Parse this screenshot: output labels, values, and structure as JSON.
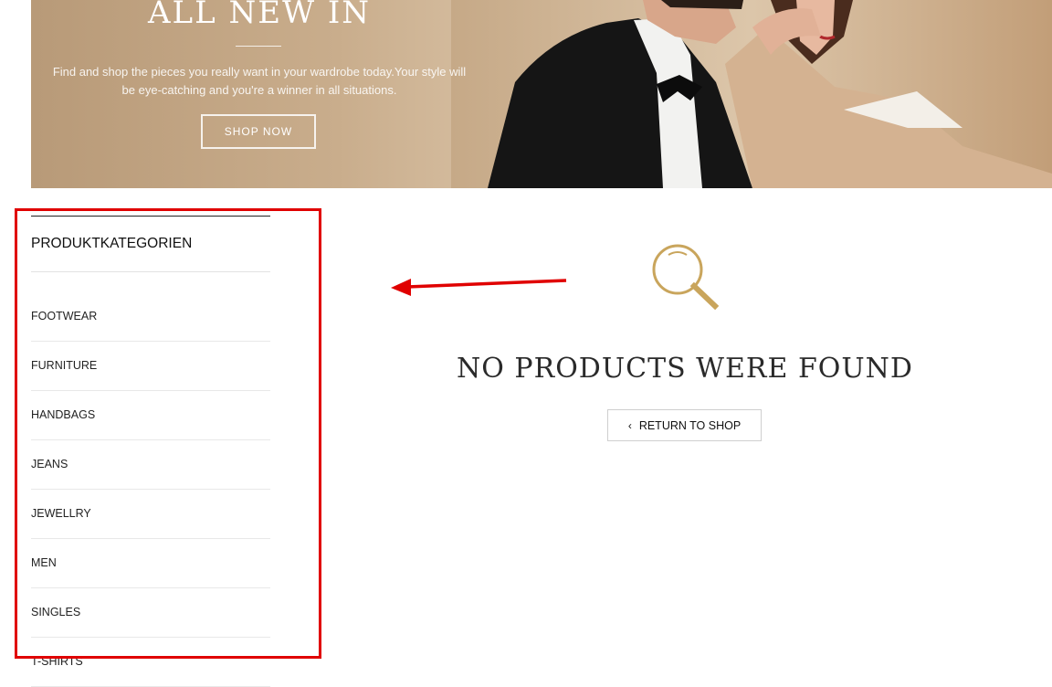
{
  "banner": {
    "title": "ALL NEW IN",
    "text": "Find and shop the pieces you really want in your wardrobe today.Your style will be eye-catching and you're a winner in all situations.",
    "cta_label": "SHOP NOW"
  },
  "sidebar": {
    "title": "PRODUKTKATEGORIEN",
    "items": [
      {
        "label": "FOOTWEAR"
      },
      {
        "label": "FURNITURE"
      },
      {
        "label": "HANDBAGS"
      },
      {
        "label": "JEANS"
      },
      {
        "label": "JEWELLRY"
      },
      {
        "label": "MEN"
      },
      {
        "label": "SINGLES"
      },
      {
        "label": "T-SHIRTS"
      }
    ]
  },
  "empty_state": {
    "icon": "search-icon",
    "message": "NO PRODUCTS WERE FOUND",
    "return_label": "RETURN TO SHOP",
    "return_icon": "chevron-left-icon"
  },
  "colors": {
    "accent_gold": "#c9a55c",
    "annotation_red": "#e00000"
  }
}
